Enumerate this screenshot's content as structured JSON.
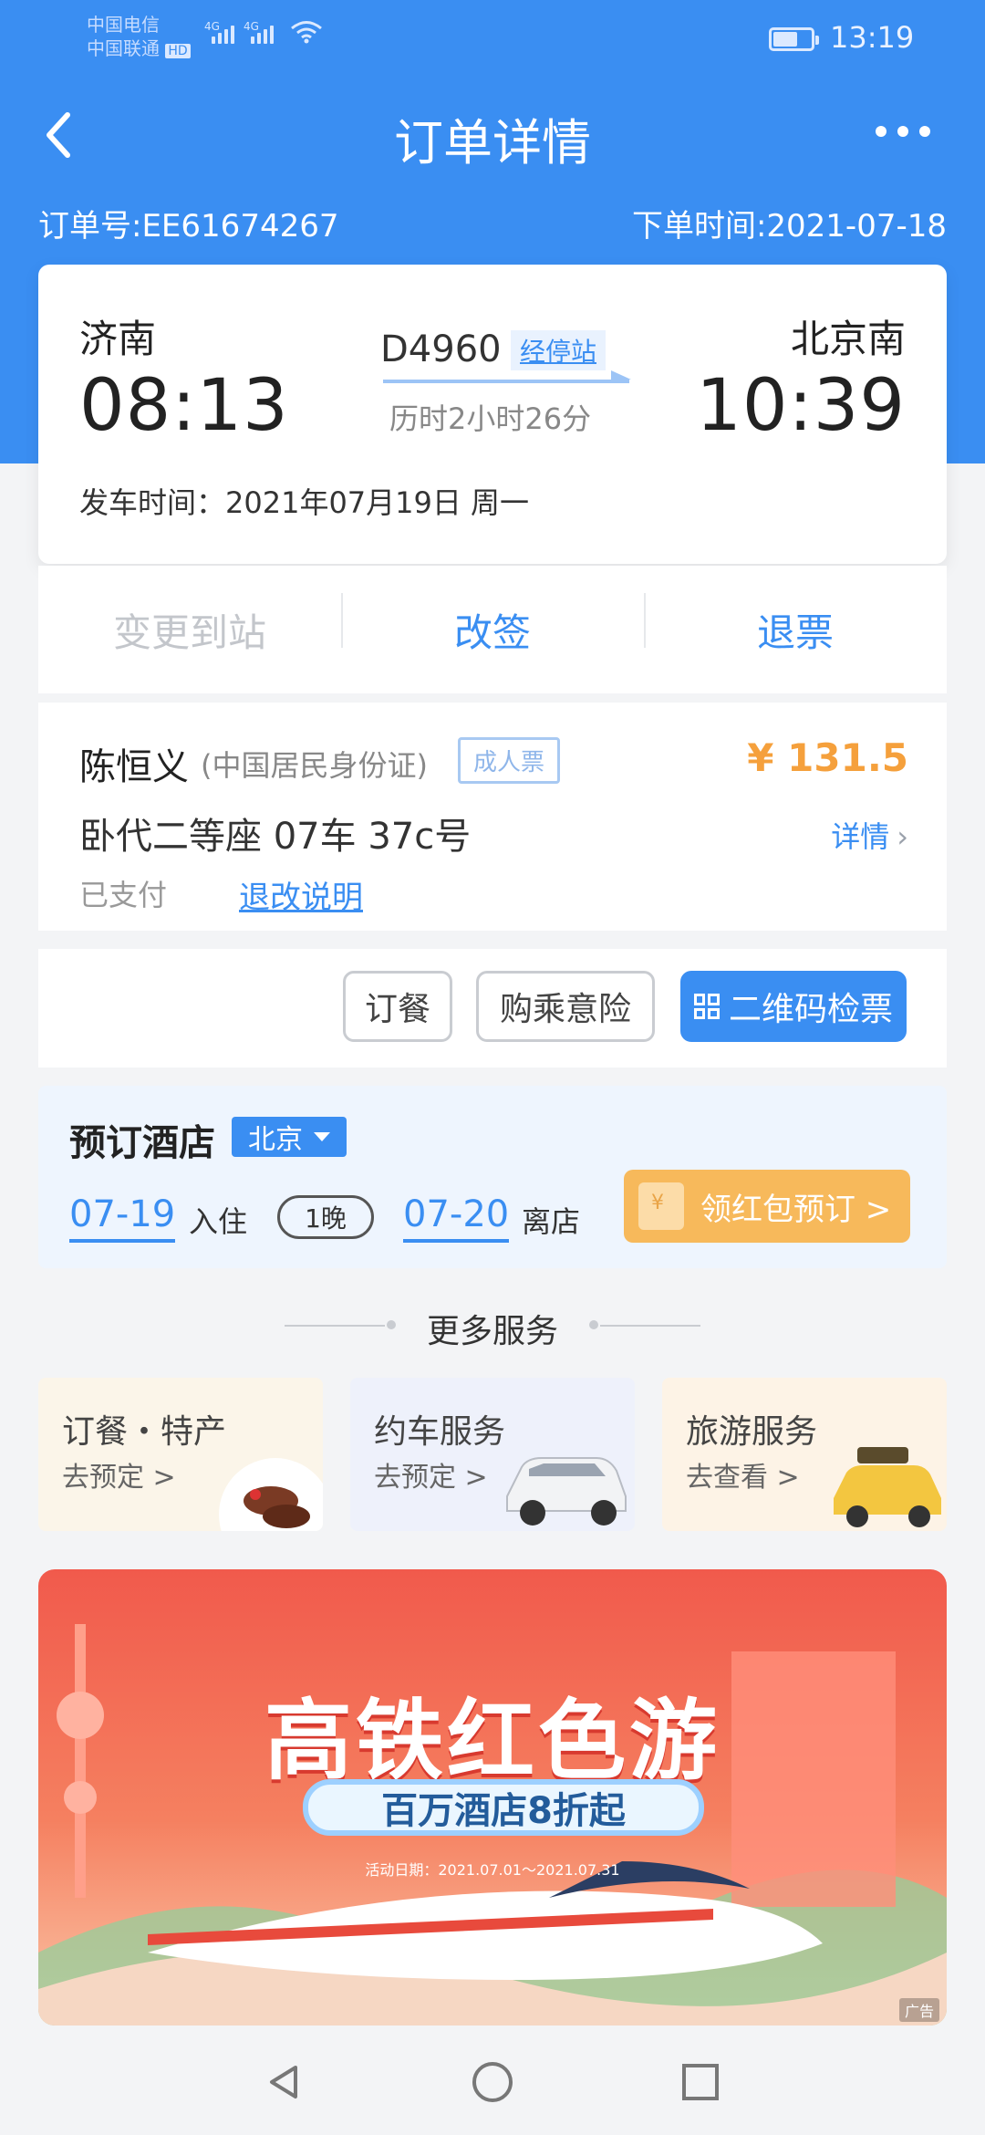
{
  "status_bar": {
    "carrier_1": "中国电信",
    "carrier_2": "中国联通",
    "hd": "HD",
    "network_1": "4G",
    "network_2": "4G",
    "time": "13:19",
    "battery_level": 0.6
  },
  "nav": {
    "title": "订单详情",
    "back_icon": "back-chevron-icon",
    "more_icon": "more-dots-icon"
  },
  "order": {
    "number_label": "订单号:EE61674267",
    "time_label": "下单时间:2021-07-18"
  },
  "train": {
    "from_station": "济南",
    "to_station": "北京南",
    "depart_time": "08:13",
    "arrive_time": "10:39",
    "train_no": "D4960",
    "stops_link": "经停站",
    "duration": "历时2小时26分",
    "depart_date": "发车时间：2021年07月19日 周一"
  },
  "actions": {
    "change_station": "变更到站",
    "reschedule": "改签",
    "refund": "退票"
  },
  "passenger": {
    "name": "陈恒义",
    "id_type": "(中国居民身份证)",
    "ticket_type": "成人票",
    "price": "¥ 131.5",
    "seat": "卧代二等座 07车 37c号",
    "detail_link": "详情",
    "status": "已支付",
    "rules_link": "退改说明"
  },
  "buttons": {
    "meal": "订餐",
    "insurance": "购乘意险",
    "qr": "二维码检票"
  },
  "hotel": {
    "title": "预订酒店",
    "city": "北京",
    "checkin_date": "07-19",
    "checkin_label": "入住",
    "nights": "1晚",
    "checkout_date": "07-20",
    "checkout_label": "离店",
    "cta": "领红包预订 >"
  },
  "more_services": {
    "title": "更多服务",
    "items": [
      {
        "title": "订餐・特产",
        "sub": "去预定 >"
      },
      {
        "title": "约车服务",
        "sub": "去预定 >"
      },
      {
        "title": "旅游服务",
        "sub": "去查看 >"
      }
    ]
  },
  "banner": {
    "title": "高铁红色游",
    "subtitle": "百万酒店8折起",
    "date": "活动日期：2021.07.01～2021.07.31",
    "ad": "广告"
  },
  "colors": {
    "primary": "#3a8ef2",
    "price": "#f5a03c",
    "hotel_cta": "#f7b95b",
    "banner_red": "#f15a4c"
  }
}
